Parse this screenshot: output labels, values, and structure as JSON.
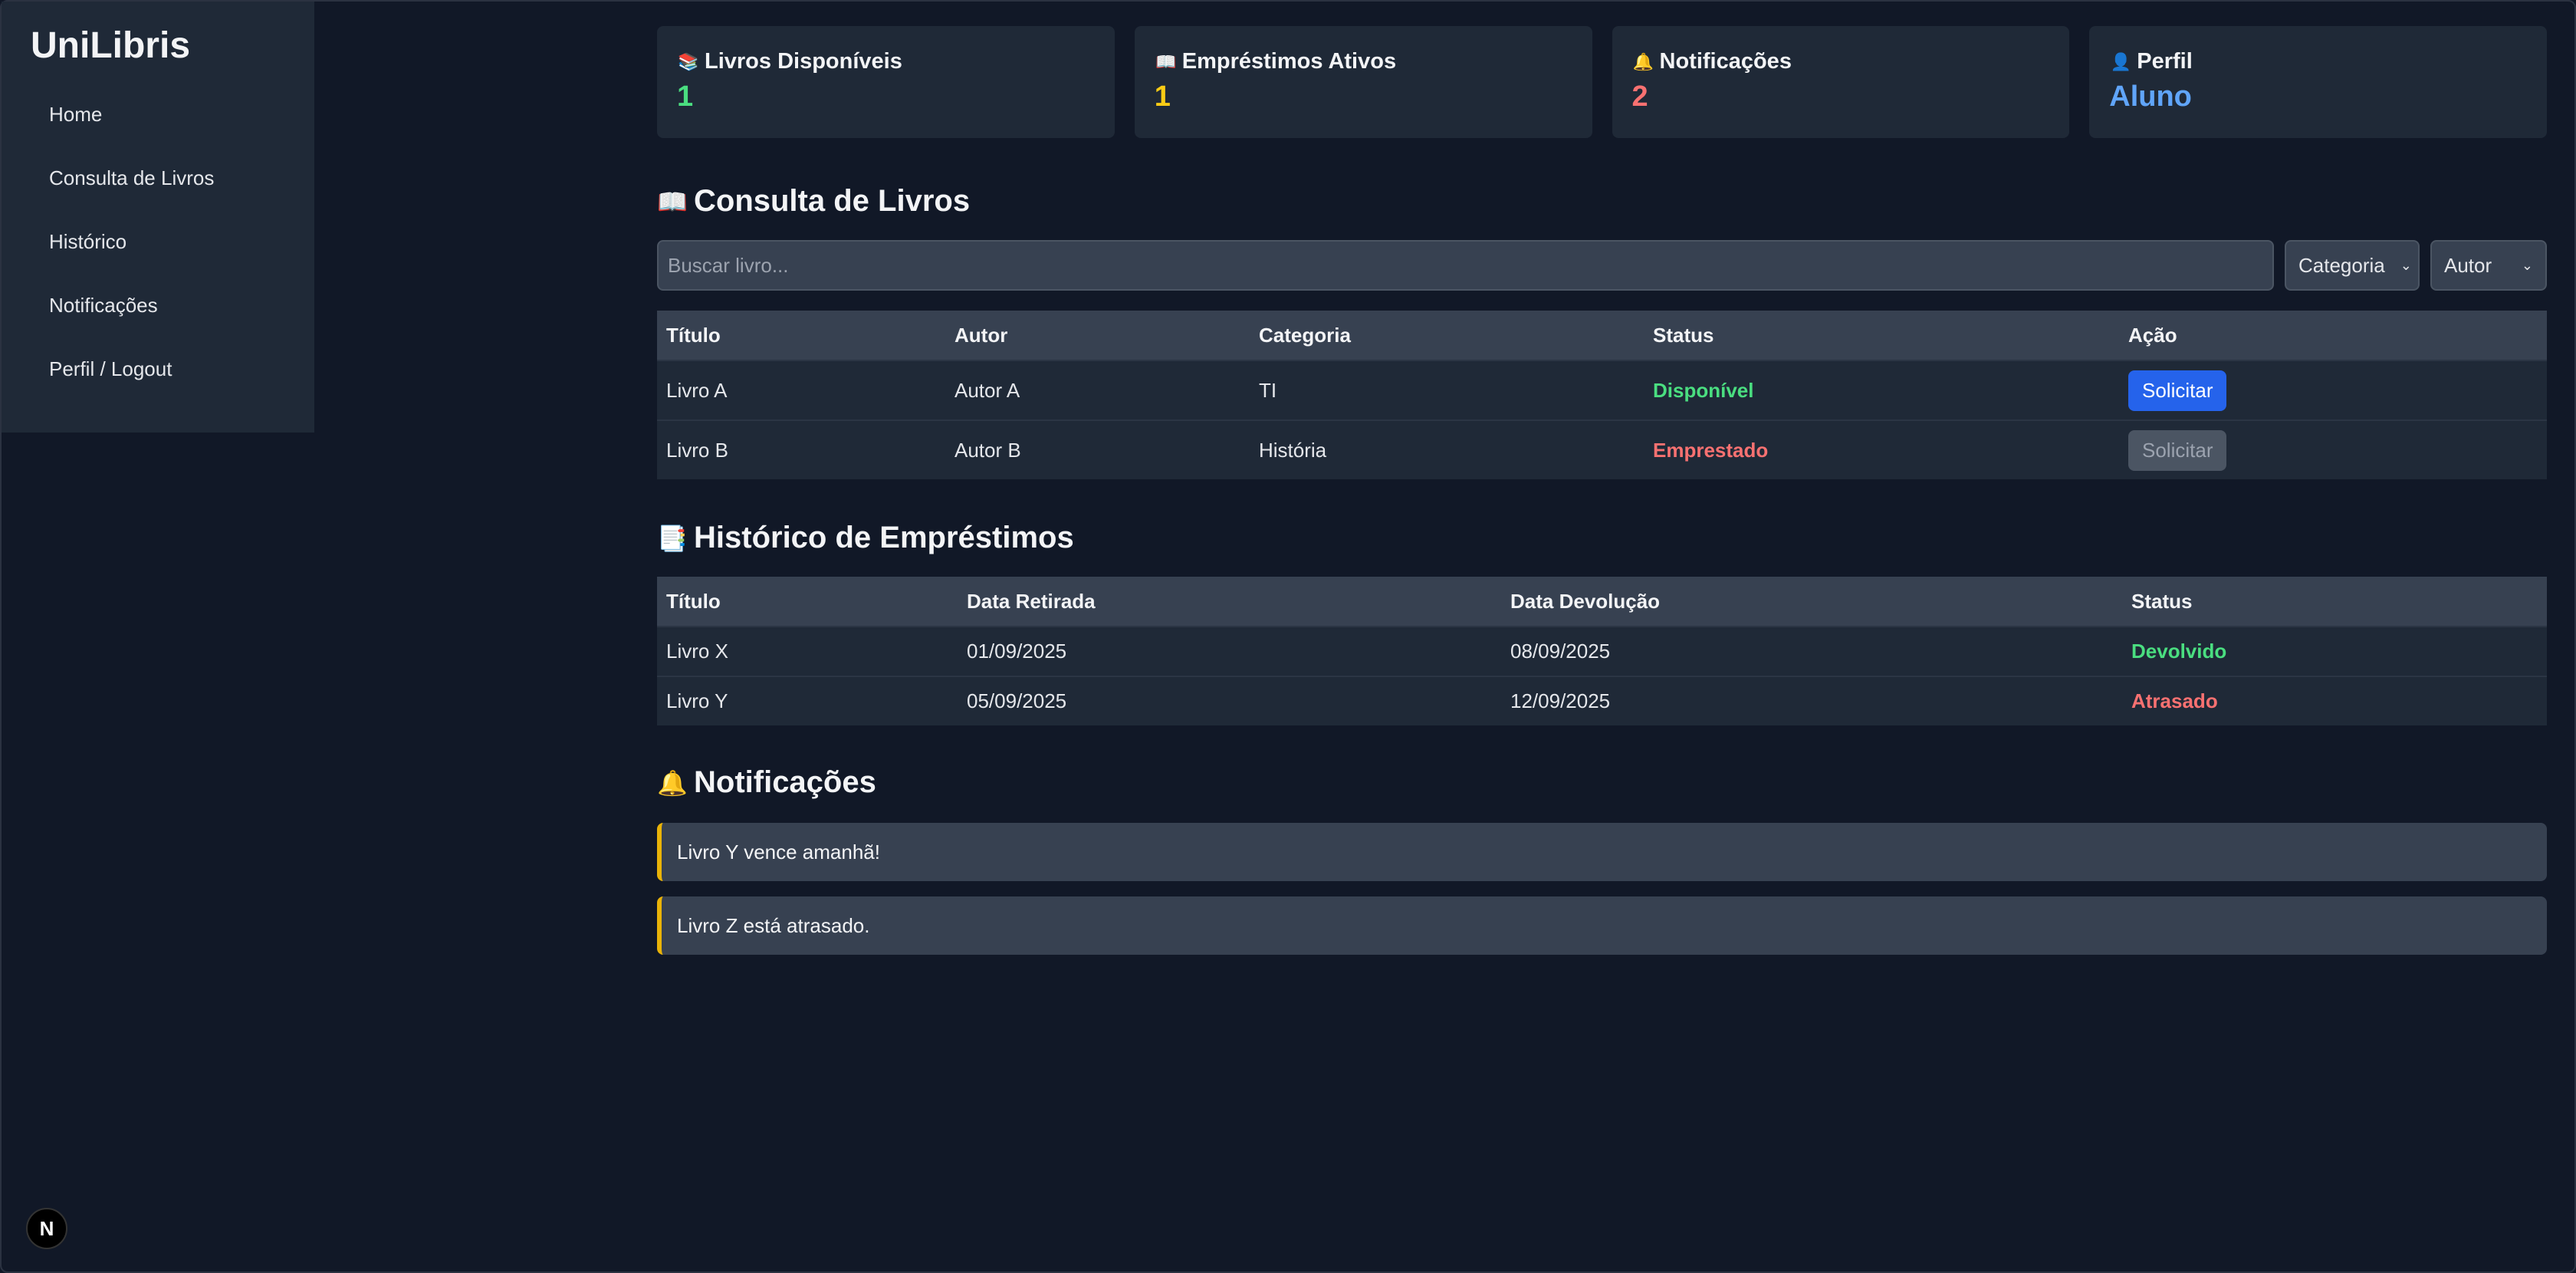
{
  "sidebar": {
    "brand": "UniLibris",
    "items": [
      {
        "label": "Home"
      },
      {
        "label": "Consulta de Livros"
      },
      {
        "label": "Histórico"
      },
      {
        "label": "Notificações"
      },
      {
        "label": "Perfil / Logout"
      }
    ]
  },
  "cards": [
    {
      "icon": "books-icon",
      "glyph": "📚",
      "title": "Livros Disponíveis",
      "value": "1",
      "color": "#4ade80"
    },
    {
      "icon": "open-book-icon",
      "glyph": "📖",
      "title": "Empréstimos Ativos",
      "value": "1",
      "color": "#facc15"
    },
    {
      "icon": "bell-icon",
      "glyph": "🔔",
      "title": "Notificações",
      "value": "2",
      "color": "#f87171"
    },
    {
      "icon": "user-icon",
      "glyph": "👤",
      "title": "Perfil",
      "value": "Aluno",
      "color": "#60a5fa"
    }
  ],
  "consulta": {
    "icon": "open-book-icon",
    "glyph": "📖",
    "title": "Consulta de Livros",
    "search_placeholder": "Buscar livro...",
    "category_select": "Categoria",
    "author_select": "Autor",
    "headers": [
      "Título",
      "Autor",
      "Categoria",
      "Status",
      "Ação"
    ],
    "rows": [
      {
        "titulo": "Livro A",
        "autor": "Autor A",
        "categoria": "TI",
        "status": "Disponível",
        "action": "Solicitar"
      },
      {
        "titulo": "Livro B",
        "autor": "Autor B",
        "categoria": "História",
        "status": "Emprestado",
        "action": "Solicitar"
      }
    ]
  },
  "historico": {
    "icon": "ledger-icon",
    "glyph": "📑",
    "title": "Histórico de Empréstimos",
    "headers": [
      "Título",
      "Data Retirada",
      "Data Devolução",
      "Status"
    ],
    "rows": [
      {
        "titulo": "Livro X",
        "retirada": "01/09/2025",
        "devolucao": "08/09/2025",
        "status": "Devolvido"
      },
      {
        "titulo": "Livro Y",
        "retirada": "05/09/2025",
        "devolucao": "12/09/2025",
        "status": "Atrasado"
      }
    ]
  },
  "notificacoes": {
    "icon": "bell-icon",
    "glyph": "🔔",
    "title": "Notificações",
    "items": [
      "Livro Y vence amanhã!",
      "Livro Z está atrasado."
    ]
  },
  "badge": {
    "letter": "N"
  },
  "colors": {
    "accent": "#2563eb",
    "success": "#4ade80",
    "danger": "#f87171",
    "warning": "#eab308"
  }
}
